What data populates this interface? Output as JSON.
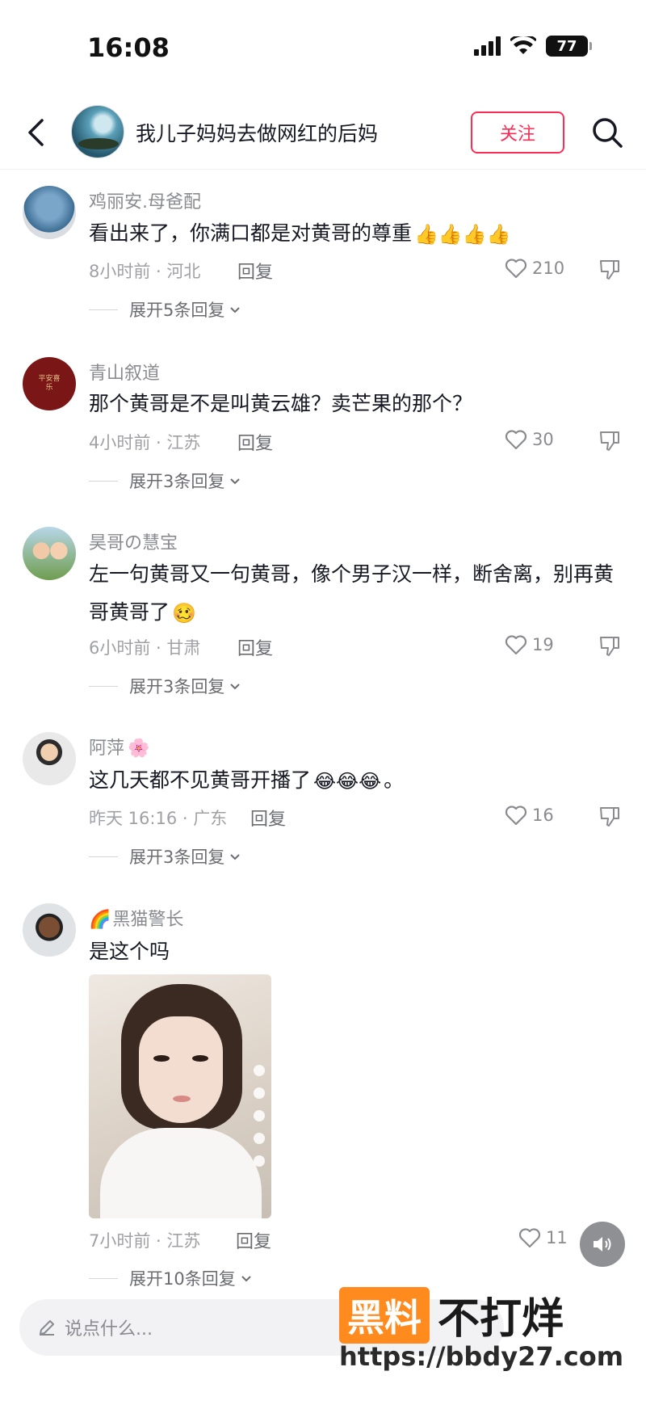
{
  "status": {
    "time": "16:08",
    "battery": "77"
  },
  "nav": {
    "title": "我儿子妈妈去做网红的后妈",
    "follow_label": "关注"
  },
  "comments": [
    {
      "username": "鸡丽安.母爸配",
      "content": "看出来了，你满口都是对黄哥的尊重",
      "emojis": "👍👍👍👍",
      "meta": "8小时前 · 河北",
      "reply": "回复",
      "likes": "210",
      "expand": "展开5条回复"
    },
    {
      "username": "青山叙道",
      "content": "那个黄哥是不是叫黄云雄？卖芒果的那个？",
      "emojis": "",
      "meta": "4小时前 · 江苏",
      "reply": "回复",
      "likes": "30",
      "expand": "展开3条回复",
      "avatar_text": "平安喜乐"
    },
    {
      "username": "昊哥の慧宝",
      "content": "左一句黄哥又一句黄哥，像个男子汉一样，断舍离，别再黄哥黄哥了",
      "emojis": "🥴",
      "meta": "6小时前 · 甘肃",
      "reply": "回复",
      "likes": "19",
      "expand": "展开3条回复"
    },
    {
      "username": "阿萍",
      "username_emoji": "🌸",
      "content": "这几天都不见黄哥开播了",
      "emojis": "😂😂😂",
      "content_tail": "。",
      "meta": "昨天 16:16 · 广东",
      "reply": "回复",
      "likes": "16",
      "expand": "展开3条回复"
    },
    {
      "username": "黑猫警长",
      "username_emoji": "🌈",
      "content": "是这个吗",
      "emojis": "",
      "meta": "7小时前 · 江苏",
      "reply": "回复",
      "likes": "11",
      "expand": "展开10条回复"
    }
  ],
  "input": {
    "placeholder": "说点什么..."
  },
  "watermark": {
    "badge": "黑料",
    "text": "不打烊",
    "url": "https://bbdy27.com"
  },
  "colors": {
    "accent": "#fe2c55",
    "watermark_orange": "#ff8a1e"
  }
}
